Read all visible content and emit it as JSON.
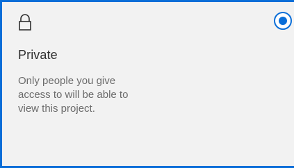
{
  "option": {
    "title": "Private",
    "description": "Only people you give\naccess to will be able to\nview this project.",
    "selected": true,
    "icon": "lock-icon",
    "accent_color": "#0a6ed8"
  }
}
